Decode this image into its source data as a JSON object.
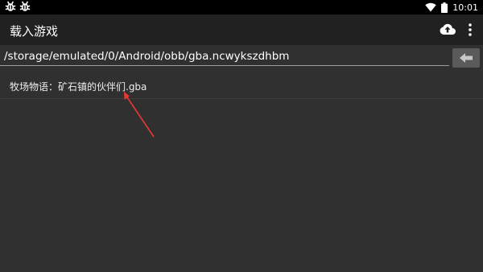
{
  "status_bar": {
    "left_icons": [
      "debug-bug-icon",
      "debug-bug-icon"
    ],
    "right_icons": [
      "wifi-icon",
      "battery-icon"
    ],
    "time": "10:01"
  },
  "app_bar": {
    "title": "载入游戏",
    "actions": [
      "cloud-upload-icon",
      "more-vert-icon"
    ]
  },
  "path_bar": {
    "value": "/storage/emulated/0/Android/obb/gba.ncwykszdhbm",
    "back_icon": "arrow-back-icon"
  },
  "file_list": [
    {
      "name": "牧场物语：矿石镇的伙伴们.gba"
    }
  ],
  "annotation": {
    "color": "#e53935",
    "points_to": "file-item"
  },
  "colors": {
    "background": "#303030",
    "status_bar": "#000000",
    "app_bar": "#212121",
    "back_button": "#5a5a5a"
  }
}
